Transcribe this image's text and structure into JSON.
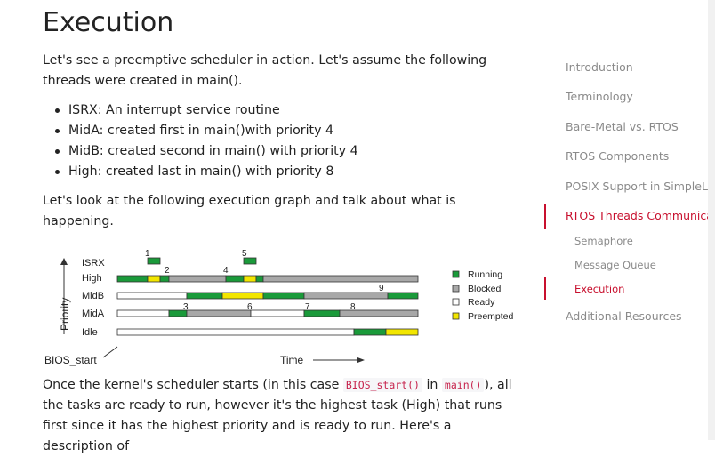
{
  "article": {
    "title": "Execution",
    "intro": "Let's see a preemptive scheduler in action. Let's assume the following threads were created in main().",
    "threads": [
      "ISRX: An interrupt service routine",
      "MidA: created first in main()with priority 4",
      "MidB: created second in main() with priority 4",
      "High: created last in main() with priority 8"
    ],
    "graph_intro": "Let's look at the following execution graph and talk about what is happening.",
    "outro": {
      "part1": "Once the kernel's scheduler starts (in this case ",
      "code1": "BIOS_start()",
      "part2": " in ",
      "code2": "main()",
      "part3": "), all the tasks are ready to run, however it's the highest task (High) that runs first since it has the highest priority and is ready to run. Here's a description of"
    }
  },
  "diagram": {
    "rows": [
      "ISRX",
      "High",
      "MidB",
      "MidA",
      "Idle"
    ],
    "y_axis_label": "Priority",
    "x_axis_label": "Time",
    "origin_label": "BIOS_start",
    "markers": [
      "1",
      "2",
      "3",
      "4",
      "5",
      "6",
      "7",
      "8",
      "9"
    ],
    "legend": [
      "Running",
      "Blocked",
      "Ready",
      "Preempted"
    ],
    "colors": {
      "running": "#1a9a3a",
      "blocked": "#a8a8a8",
      "ready": "#ffffff",
      "preempted": "#f2e600"
    }
  },
  "toc": {
    "items": [
      "Introduction",
      "Terminology",
      "Bare-Metal vs. RTOS",
      "RTOS Components",
      "POSIX Support in SimpleLink",
      "RTOS Threads Communication",
      "Semaphore",
      "Message Queue",
      "Execution",
      "Additional Resources"
    ],
    "accent_color": "#c8102e"
  }
}
